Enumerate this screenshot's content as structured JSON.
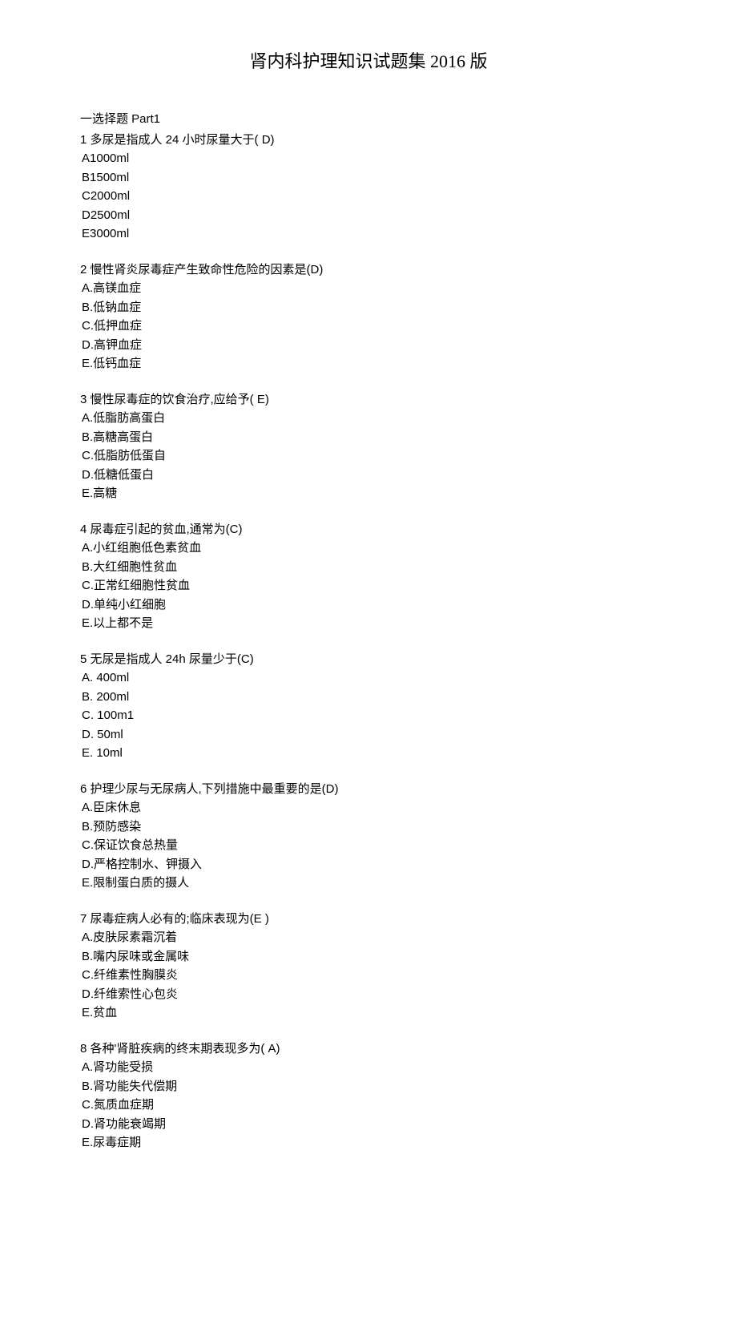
{
  "title": "肾内科护理知识试题集 2016 版",
  "sectionHeader": "一选择题 Part1",
  "questions": [
    {
      "text": "1  多尿是指成人 24 小时尿量大于( D)",
      "options": [
        "A1000ml",
        "B1500ml",
        "C2000ml",
        "D2500ml",
        "E3000ml"
      ]
    },
    {
      "text": "2 慢性肾炎尿毒症产生致命性危险的因素是(D)",
      "options": [
        "A.高镁血症",
        "B.低钠血症",
        "C.低押血症",
        "D.高钾血症",
        "E.低钙血症"
      ]
    },
    {
      "text": "3  慢性尿毒症的饮食治疗,应给予( E)",
      "options": [
        "A.低脂肪高蛋白",
        "B.高糖高蛋白",
        "C.低脂肪低蛋自",
        "D.低糖低蛋白",
        "E.高糖"
      ]
    },
    {
      "text": "4  尿毒症引起的贫血,通常为(C)",
      "options": [
        "A.小红组胞低色素贫血",
        "B.大红细胞性贫血",
        "C.正常红细胞性贫血",
        "D.单纯小红细胞",
        "E.以上都不是"
      ]
    },
    {
      "text": "5  无尿是指成人 24h 尿量少于(C)",
      "options": [
        "A. 400ml",
        "B. 200ml",
        "C. 100m1",
        "D. 50ml",
        "E. 10ml"
      ]
    },
    {
      "text": "6  护理少尿与无尿病人,下列措施中最重要的是(D)",
      "options": [
        "A.臣床休息",
        "B.预防感染",
        "C.保证饮食总热量",
        "D.严格控制水、钾摄入",
        "E.限制蛋白质的摄人"
      ]
    },
    {
      "text": "7  尿毒症病人必有的;临床表现为(E )",
      "options": [
        "A.皮肤尿素霜沉着",
        "B.嘴内尿味或金属味",
        "C.纤维素性胸膜炎",
        "D.纤维索性心包炎",
        "E.贫血"
      ]
    },
    {
      "text": "8  各种'肾脏疾病的终末期表现多为( A)",
      "options": [
        "A.肾功能受损",
        "B.肾功能失代偿期",
        "C.氮质血症期",
        "D.肾功能衰竭期",
        "E.尿毒症期"
      ]
    }
  ]
}
